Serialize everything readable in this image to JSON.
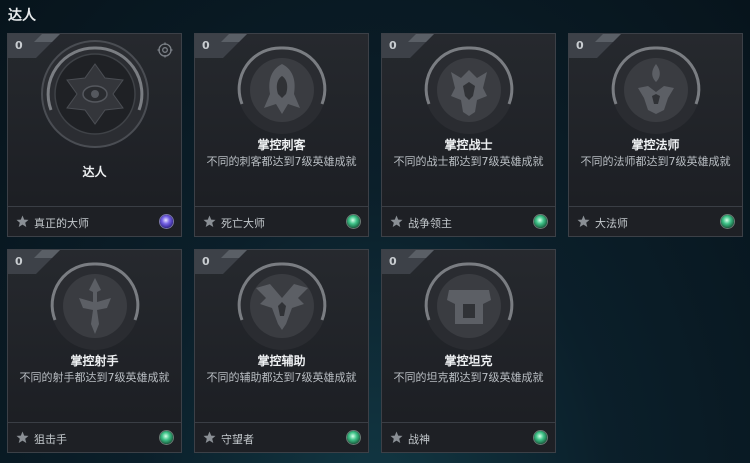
{
  "page": {
    "title": "达人"
  },
  "cards": [
    {
      "count": "0",
      "title": "达人",
      "desc": "",
      "footer": "真正的大师",
      "gem": "purple",
      "emblem": "master-emblem-icon"
    },
    {
      "count": "0",
      "title": "掌控刺客",
      "desc": "不同的刺客都达到7级英雄成就",
      "footer": "死亡大师",
      "gem": "green",
      "emblem": "assassin-emblem-icon"
    },
    {
      "count": "0",
      "title": "掌控战士",
      "desc": "不同的战士都达到7级英雄成就",
      "footer": "战争领主",
      "gem": "green",
      "emblem": "fighter-emblem-icon"
    },
    {
      "count": "0",
      "title": "掌控法师",
      "desc": "不同的法师都达到7级英雄成就",
      "footer": "大法师",
      "gem": "green",
      "emblem": "mage-emblem-icon"
    },
    {
      "count": "0",
      "title": "掌控射手",
      "desc": "不同的射手都达到7级英雄成就",
      "footer": "狙击手",
      "gem": "green",
      "emblem": "marksman-emblem-icon"
    },
    {
      "count": "0",
      "title": "掌控辅助",
      "desc": "不同的辅助都达到7级英雄成就",
      "footer": "守望者",
      "gem": "green",
      "emblem": "support-emblem-icon"
    },
    {
      "count": "0",
      "title": "掌控坦克",
      "desc": "不同的坦克都达到7级英雄成就",
      "footer": "战神",
      "gem": "green",
      "emblem": "tank-emblem-icon"
    }
  ]
}
